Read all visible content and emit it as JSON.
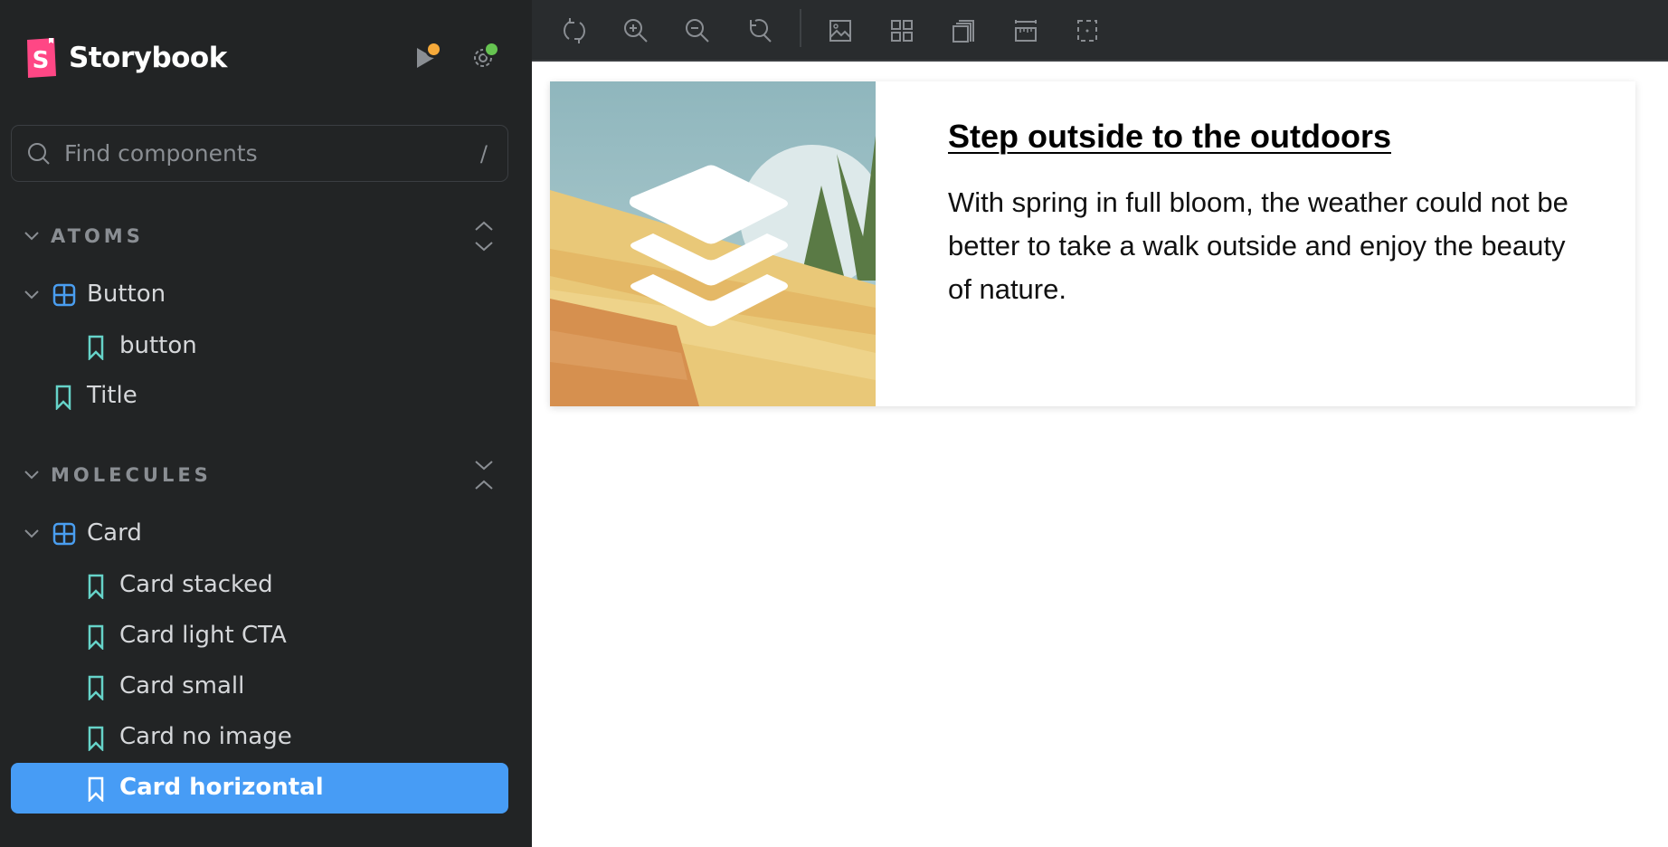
{
  "app": {
    "name": "Storybook",
    "logo_letter": "S",
    "colors": {
      "brand_pink": "#ff4785",
      "accent_blue": "#479cf5",
      "story_teal": "#66d3c9",
      "component_blue": "#4a9ef0",
      "status_orange": "#f5a93a",
      "status_green": "#66c451"
    }
  },
  "header": {
    "play_icon": "play-icon",
    "settings_icon": "gear-icon"
  },
  "search": {
    "placeholder": "Find components",
    "value": "",
    "shortcut": "/"
  },
  "sidebar": {
    "groups": [
      {
        "label": "ATOMS",
        "toggle_icon": "expand-all-icon",
        "items": [
          {
            "label": "Button",
            "type": "component",
            "expanded": true
          },
          {
            "label": "button",
            "type": "story",
            "depth": 2
          },
          {
            "label": "Title",
            "type": "story",
            "depth": 1
          }
        ]
      },
      {
        "label": "MOLECULES",
        "toggle_icon": "collapse-all-icon",
        "items": [
          {
            "label": "Card",
            "type": "component",
            "expanded": true
          },
          {
            "label": "Card stacked",
            "type": "story",
            "depth": 2
          },
          {
            "label": "Card light CTA",
            "type": "story",
            "depth": 2
          },
          {
            "label": "Card small",
            "type": "story",
            "depth": 2
          },
          {
            "label": "Card no image",
            "type": "story",
            "depth": 2
          },
          {
            "label": "Card horizontal",
            "type": "story",
            "depth": 2,
            "selected": true
          }
        ]
      }
    ]
  },
  "toolbar": {
    "buttons": [
      {
        "name": "remount",
        "icon": "sync-icon",
        "title": "Remount component"
      },
      {
        "name": "zoom-in",
        "icon": "zoom-in-icon",
        "title": "Zoom in"
      },
      {
        "name": "zoom-out",
        "icon": "zoom-out-icon",
        "title": "Zoom out"
      },
      {
        "name": "reset-zoom",
        "icon": "zoom-reset-icon",
        "title": "Reset zoom"
      },
      {
        "name": "backgrounds",
        "icon": "photo-icon",
        "title": "Change the background of the preview"
      },
      {
        "name": "grid",
        "icon": "grid-icon",
        "title": "Apply a grid to the preview"
      },
      {
        "name": "viewport",
        "icon": "viewport-icon",
        "title": "Change the size of the preview"
      },
      {
        "name": "measure",
        "icon": "ruler-icon",
        "title": "Enable measure"
      },
      {
        "name": "outline",
        "icon": "outline-icon",
        "title": "Apply outlines to the preview"
      }
    ]
  },
  "preview": {
    "card": {
      "title": "Step outside to the outdoors",
      "text": "With spring in full bloom, the weather could not be better to take a walk outside and enjoy the beauty of nature."
    }
  }
}
